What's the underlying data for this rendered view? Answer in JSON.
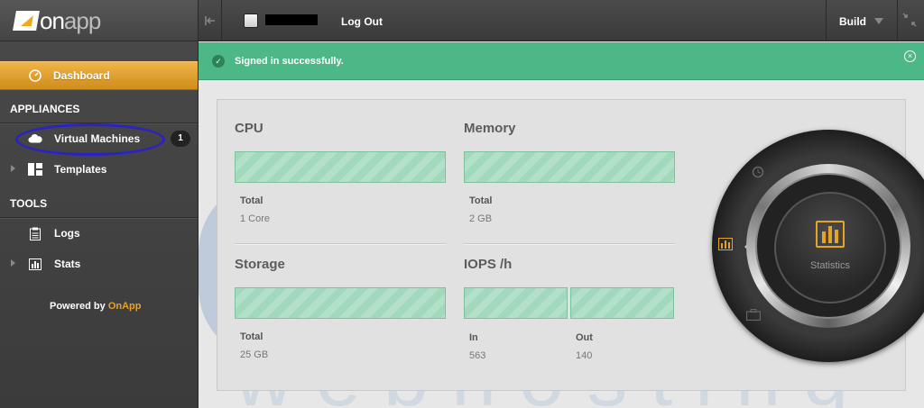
{
  "app": {
    "logo_text_on": "on",
    "logo_text_app": "app"
  },
  "topbar": {
    "logout_label": "Log Out",
    "build_label": "Build"
  },
  "sidebar": {
    "dashboard_label": "Dashboard",
    "sections": [
      {
        "title": "APPLIANCES"
      },
      {
        "title": "TOOLS"
      }
    ],
    "items": [
      {
        "label": "Virtual Machines",
        "icon": "cloud-icon",
        "badge": "1"
      },
      {
        "label": "Templates",
        "icon": "templates-icon"
      },
      {
        "label": "Logs",
        "icon": "clipboard-icon"
      },
      {
        "label": "Stats",
        "icon": "bar-chart-icon"
      }
    ],
    "powered_prefix": "Powered by",
    "powered_brand": "OnApp"
  },
  "alert": {
    "message": "Signed in successfully.",
    "color": "#4db887"
  },
  "metrics": {
    "cpu": {
      "title": "CPU",
      "total_label": "Total",
      "total_value": "1 Core"
    },
    "memory": {
      "title": "Memory",
      "total_label": "Total",
      "total_value": "2 GB"
    },
    "storage": {
      "title": "Storage",
      "total_label": "Total",
      "total_value": "25 GB"
    },
    "iops": {
      "title": "IOPS /h",
      "in_label": "In",
      "in_value": "563",
      "out_label": "Out",
      "out_value": "140"
    }
  },
  "dial": {
    "center_label": "Statistics"
  },
  "watermark": {
    "text": "w e b   h o s t i n g"
  },
  "colors": {
    "accent": "#e6a22b",
    "bar_fill": "#a2d8bb",
    "highlight_ring": "#2a22c9"
  }
}
